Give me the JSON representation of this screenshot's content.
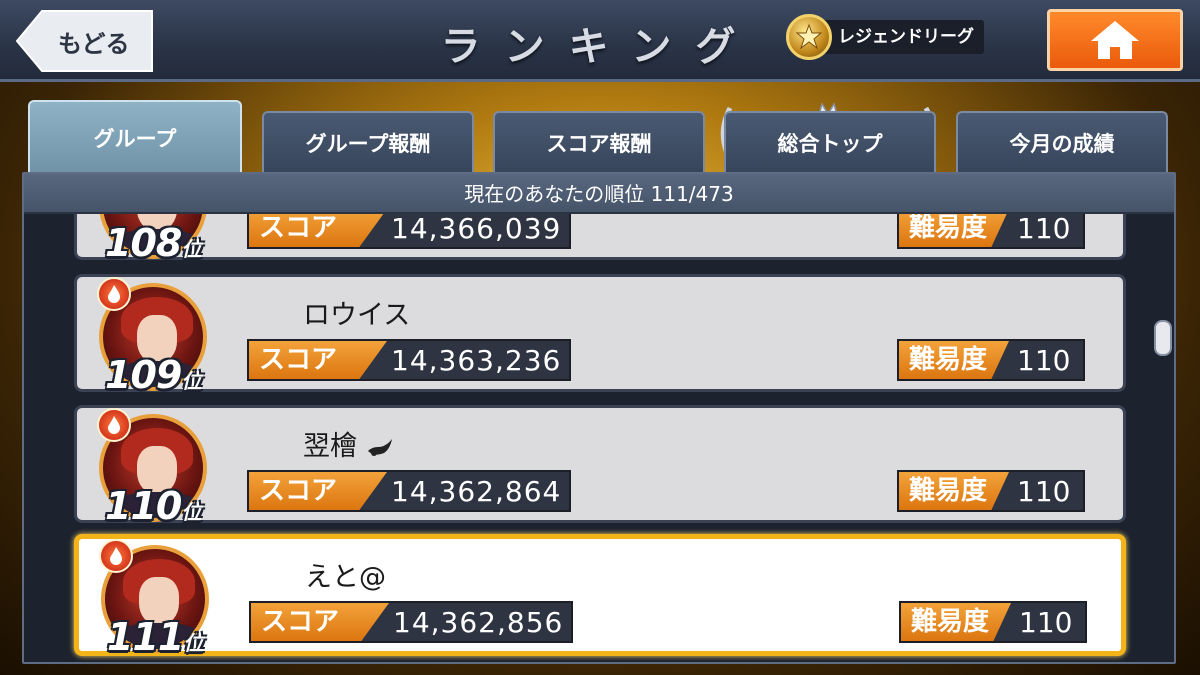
{
  "header": {
    "back_label": "もどる",
    "title": "ランキング",
    "league_name": "レジェンドリーグ"
  },
  "tabs": [
    {
      "label": "グループ",
      "active": true
    },
    {
      "label": "グループ報酬",
      "active": false
    },
    {
      "label": "スコア報酬",
      "active": false
    },
    {
      "label": "総合トップ",
      "active": false
    },
    {
      "label": "今月の成績",
      "active": false
    }
  ],
  "rank_status": "現在のあなたの順位 111/473",
  "score_label": "スコア",
  "difficulty_label": "難易度",
  "rank_suffix": "位",
  "entries": [
    {
      "rank": "108",
      "name": "",
      "score": "14,366,039",
      "difficulty": "110",
      "is_me": false
    },
    {
      "rank": "109",
      "name": "ロウイス",
      "score": "14,363,236",
      "difficulty": "110",
      "is_me": false
    },
    {
      "rank": "110",
      "name": "翌檜",
      "score": "14,362,864",
      "difficulty": "110",
      "is_me": false
    },
    {
      "rank": "111",
      "name": "えと@",
      "score": "14,362,856",
      "difficulty": "110",
      "is_me": true
    }
  ],
  "colors": {
    "accent_orange": "#e9821c",
    "highlight_gold": "#f3b41a",
    "header_navy": "#2a3447"
  }
}
